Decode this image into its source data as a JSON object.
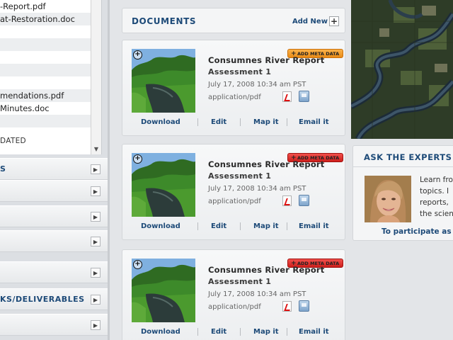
{
  "sidebar": {
    "files": [
      {
        "name": "-Report.pdf",
        "alt": false
      },
      {
        "name": "at-Restoration.doc",
        "alt": true
      },
      {
        "name": "",
        "alt": false
      },
      {
        "name": "",
        "alt": true
      },
      {
        "name": "",
        "alt": false
      },
      {
        "name": "",
        "alt": true
      },
      {
        "name": "",
        "alt": false
      },
      {
        "name": "mendations.pdf",
        "alt": true
      },
      {
        "name": "Minutes.doc",
        "alt": false
      },
      {
        "name": "",
        "alt": true
      },
      {
        "name": "DATED",
        "alt": false
      }
    ],
    "accordion": [
      {
        "label": "S"
      },
      {
        "label": ""
      },
      {
        "label": ""
      },
      {
        "label": ""
      },
      {
        "label": ""
      },
      {
        "label": "KS/DELIVERABLES"
      },
      {
        "label": ""
      }
    ]
  },
  "documents": {
    "title": "DOCUMENTS",
    "add_new": "Add New",
    "add_icon": "plus-icon",
    "meta_label": "ADD META DATA",
    "colors": {
      "accent": "#1d4a78",
      "meta_orange": "#f29a2a",
      "meta_red": "#e03a36"
    },
    "cards": [
      {
        "name": "Consumnes River Report",
        "sub": "Assessment 1",
        "date": "July 17, 2008  10:34 am PST",
        "mime": "application/pdf",
        "meta_state": "orange",
        "actions": [
          "Download",
          "Edit",
          "Map it",
          "Email it"
        ]
      },
      {
        "name": "Consumnes River Report",
        "sub": "Assessment 1",
        "date": "July 17, 2008  10:34 am PST",
        "mime": "application/pdf",
        "meta_state": "red",
        "actions": [
          "Download",
          "Edit",
          "Map it",
          "Email it"
        ]
      },
      {
        "name": "Consumnes River Report",
        "sub": "Assessment 1",
        "date": "July 17, 2008  10:34 am PST",
        "mime": "application/pdf",
        "meta_state": "red",
        "actions": [
          "Download",
          "Edit",
          "Map it",
          "Email it"
        ]
      }
    ]
  },
  "experts": {
    "title": "ASK THE EXPERTS",
    "lines": [
      "Learn fro",
      "topics.  I",
      "reports,",
      "the scien"
    ],
    "cta": "To participate as"
  }
}
